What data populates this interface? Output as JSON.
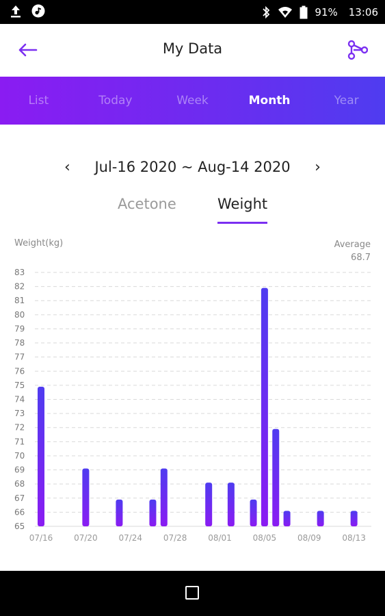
{
  "status_bar": {
    "battery": "91%",
    "time": "13:06",
    "icons": [
      "upload-icon",
      "music-app-icon",
      "bluetooth-icon",
      "wifi-icon",
      "battery-icon"
    ]
  },
  "app_bar": {
    "title": "My Data",
    "back_icon": "arrow-left-icon",
    "share_icon": "share-icon"
  },
  "tabs": [
    {
      "label": "List",
      "active": false
    },
    {
      "label": "Today",
      "active": false
    },
    {
      "label": "Week",
      "active": false
    },
    {
      "label": "Month",
      "active": true
    },
    {
      "label": "Year",
      "active": false
    }
  ],
  "date_range": {
    "label": "Jul-16 2020 ~ Aug-14 2020",
    "prev": "‹",
    "next": "›"
  },
  "subtabs": {
    "acetone": "Acetone",
    "weight": "Weight",
    "active": "weight"
  },
  "chart_header": {
    "ylabel": "Weight(kg)",
    "average_label": "Average",
    "average_value": "68.7"
  },
  "colors": {
    "accent": "#7b2ff1",
    "bar_top": "#4f3cf0",
    "bar_bottom": "#8a1cf2",
    "grid": "#d9d9d9"
  },
  "chart_data": {
    "type": "bar",
    "title": "",
    "xlabel": "",
    "ylabel": "Weight(kg)",
    "ylim": [
      65,
      83
    ],
    "yticks": [
      65,
      66,
      67,
      68,
      69,
      70,
      71,
      72,
      73,
      74,
      75,
      76,
      77,
      78,
      79,
      80,
      81,
      82,
      83
    ],
    "x_start": "07/16",
    "x_end": "08/14",
    "xticks": [
      "07/16",
      "07/20",
      "07/24",
      "07/28",
      "08/01",
      "08/05",
      "08/09",
      "08/13"
    ],
    "points": [
      {
        "date": "07/16",
        "value": 74.9
      },
      {
        "date": "07/20",
        "value": 69.1
      },
      {
        "date": "07/23",
        "value": 66.9
      },
      {
        "date": "07/26",
        "value": 66.9
      },
      {
        "date": "07/27",
        "value": 69.1
      },
      {
        "date": "07/31",
        "value": 68.1
      },
      {
        "date": "08/02",
        "value": 68.1
      },
      {
        "date": "08/04",
        "value": 66.9
      },
      {
        "date": "08/05",
        "value": 81.9
      },
      {
        "date": "08/06",
        "value": 71.9
      },
      {
        "date": "08/07",
        "value": 66.1
      },
      {
        "date": "08/10",
        "value": 66.1
      },
      {
        "date": "08/13",
        "value": 66.1
      }
    ],
    "grid": true,
    "grid_style": "dashed"
  }
}
